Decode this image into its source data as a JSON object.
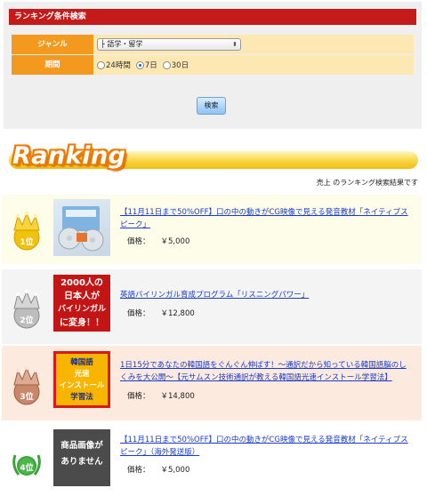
{
  "search": {
    "header": "ランキング条件検索",
    "genre_label": "ジャンル",
    "genre_value": "├ 語学・留学",
    "period_label": "期間",
    "period_options": [
      "24時間",
      "7日",
      "30日"
    ],
    "period_selected": "7日",
    "search_button": "検索"
  },
  "banner": {
    "title": "Ranking"
  },
  "result_note": "売上 のランキング検索結果です",
  "price_label": "価格：",
  "items": [
    {
      "rank": "1位",
      "title": "【11月11日まで50%OFF】口の中の動きがCG映像で見える発音教材「ネイティブスピーク」",
      "price": "￥5,000",
      "thumb_text": []
    },
    {
      "rank": "2位",
      "title": "英語バイリンガル育成プログラム「リスニングパワー」",
      "price": "￥12,800",
      "thumb_text": [
        "2000人の",
        "日本人が",
        "バイリンガル",
        "に変身！！"
      ]
    },
    {
      "rank": "3位",
      "title": "1日15分であなたの韓国語をぐんぐん伸ばす！〜通訳だから知っている韓国語脳のしくみを大公開〜【元サムスン技術通訳が教える韓国語光速インストール学習法】",
      "price": "￥14,800",
      "thumb_text": [
        "韓国語",
        "光速",
        "インストール",
        "学習法"
      ]
    },
    {
      "rank": "4位",
      "title": "【11月11日まで50%OFF】口の中の動きがCG映像で見える発音教材「ネイティブスピーク」（海外発送版）",
      "price": "￥5,000",
      "thumb_text": [
        "商品画像が",
        "ありません"
      ]
    }
  ],
  "colors": {
    "header_red": "#c41a1a",
    "label_orange": "#f39a1e",
    "value_cream": "#fde7b3",
    "link_blue": "#1a3bcc",
    "gold": "#f0bd10",
    "silver": "#b9b9b9",
    "bronze": "#c8876a",
    "green": "#3aa33a"
  }
}
